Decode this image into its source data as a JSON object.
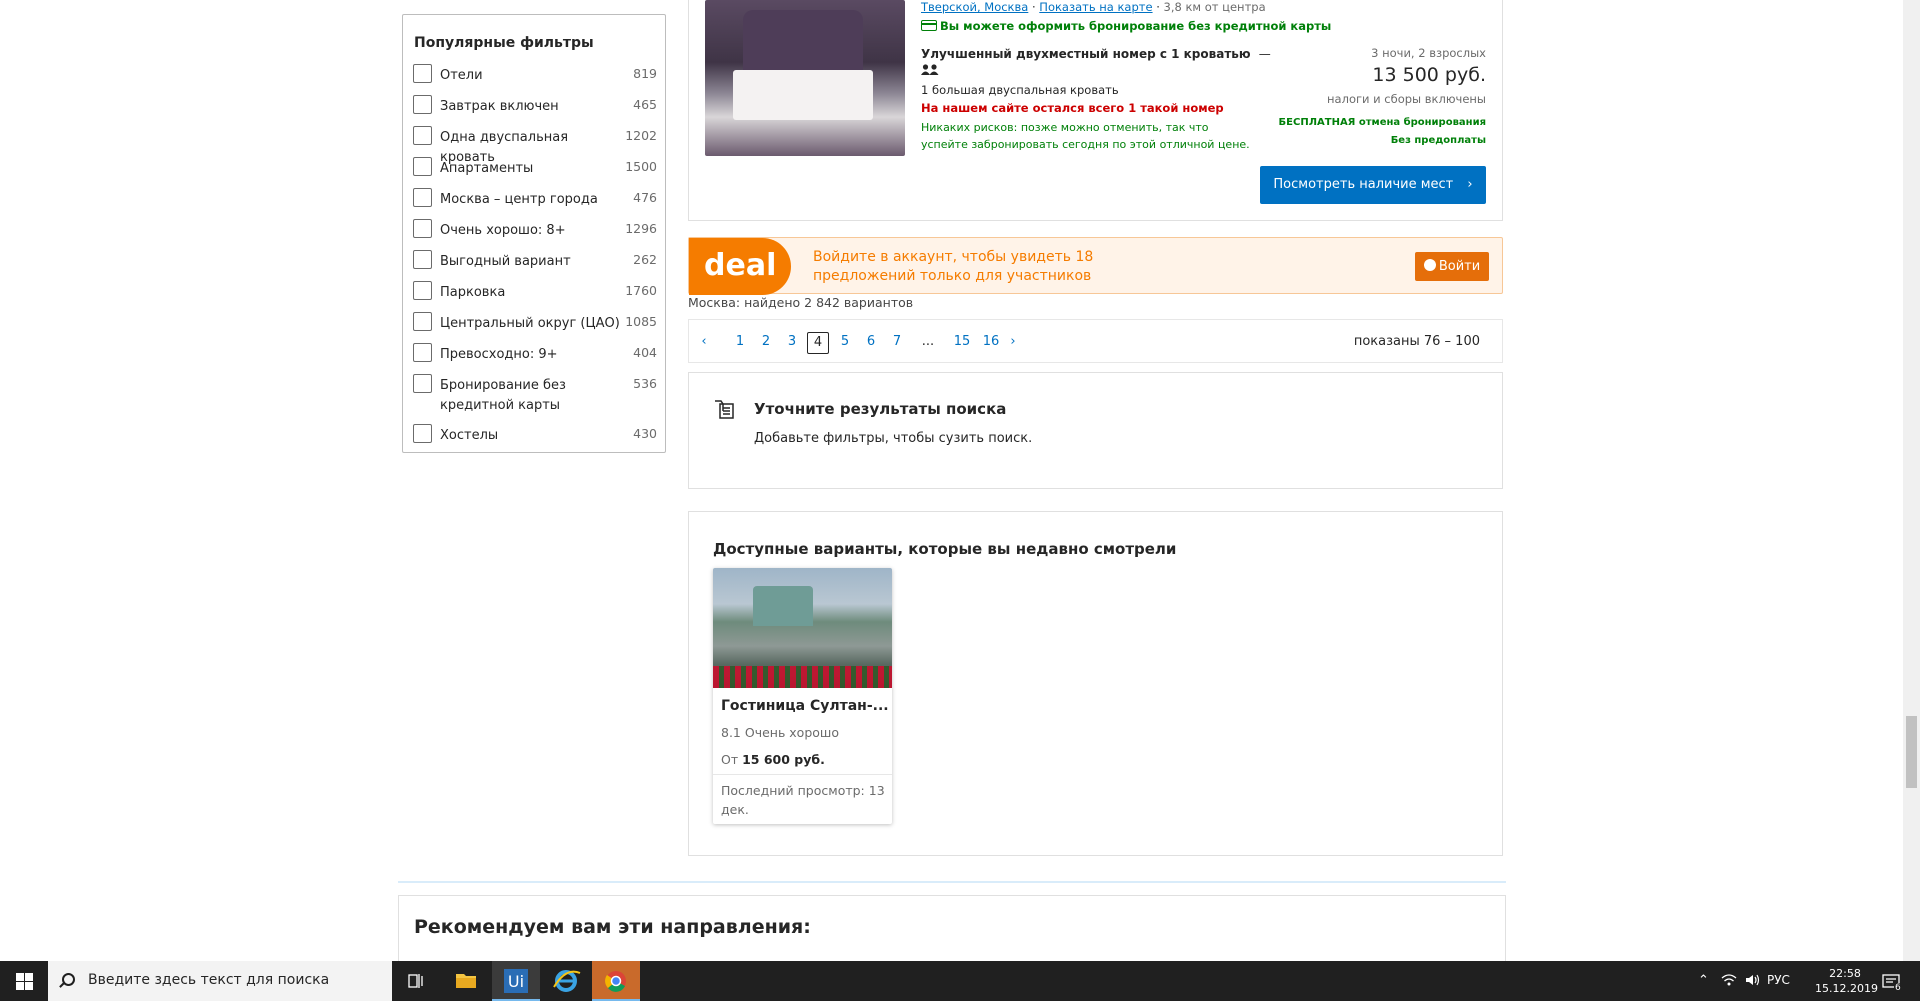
{
  "filters": {
    "title": "Популярные фильтры",
    "items": [
      {
        "label": "Отели",
        "count": "819"
      },
      {
        "label": "Завтрак включен",
        "count": "465"
      },
      {
        "label": "Одна двуспальная кровать",
        "count": "1202"
      },
      {
        "label": "Апартаменты",
        "count": "1500"
      },
      {
        "label": "Москва – центр города",
        "count": "476"
      },
      {
        "label": "Очень хорошо: 8+",
        "count": "1296"
      },
      {
        "label": "Выгодный вариант",
        "count": "262"
      },
      {
        "label": "Парковка",
        "count": "1760"
      },
      {
        "label": "Центральный округ (ЦАО)",
        "count": "1085"
      },
      {
        "label": "Превосходно: 9+",
        "count": "404"
      },
      {
        "label": "Бронирование без кредитной карты",
        "count": "536"
      },
      {
        "label": "Хостелы",
        "count": "430"
      }
    ]
  },
  "hotel": {
    "location_link": "Тверской, Москва",
    "map_link": "Показать на карте",
    "separator": "·",
    "distance": "3,8 км от центра",
    "no_card": "Вы можете оформить бронирование без кредитной карты",
    "room_title": "Улучшенный двухместный номер с 1 кроватью",
    "room_title_dash": "—",
    "bed_type": "1 большая двуспальная кровать",
    "last_room": "На нашем сайте остался всего 1 такой номер",
    "no_risk": "Никаких рисков: позже можно отменить, так что успейте забронировать сегодня по этой отличной цене.",
    "nights": "3 ночи, 2 взрослых",
    "price": "13 500 руб.",
    "taxes": "налоги и сборы включены",
    "free_cancel": "БЕСПЛАТНАЯ отмена бронирования",
    "no_prepay": "Без предоплаты",
    "avail_button": "Посмотреть наличие мест",
    "avail_chevron": "›"
  },
  "deal": {
    "badge": "deal",
    "text": "Войдите в аккаунт, чтобы увидеть 18 предложений только для участников",
    "login": "Войти"
  },
  "found": "Москва: найдено 2 842 вариантов",
  "pager": {
    "prev": "‹",
    "next": "›",
    "pages": [
      "1",
      "2",
      "3",
      "4",
      "5",
      "6",
      "7",
      "...",
      "15",
      "16"
    ],
    "current": "4",
    "shown": "показаны 76 – 100"
  },
  "refine": {
    "title": "Уточните результаты поиска",
    "subtitle": "Добавьте фильтры, чтобы сузить поиск."
  },
  "recent": {
    "title": "Доступные варианты, которые вы недавно смотрели",
    "card": {
      "name": "Гостиница Султан-...",
      "score": "8.1 Очень хорошо",
      "price_prefix": "От",
      "price": "15 600 руб.",
      "last_viewed": "Последний просмотр: 13 дек."
    }
  },
  "reco": {
    "title": "Рекомендуем вам эти направления:"
  },
  "taskbar": {
    "search_placeholder": "Введите здесь текст для поиска",
    "lang": "РУС",
    "time": "22:58",
    "date": "15.12.2019",
    "notifications": "6"
  }
}
